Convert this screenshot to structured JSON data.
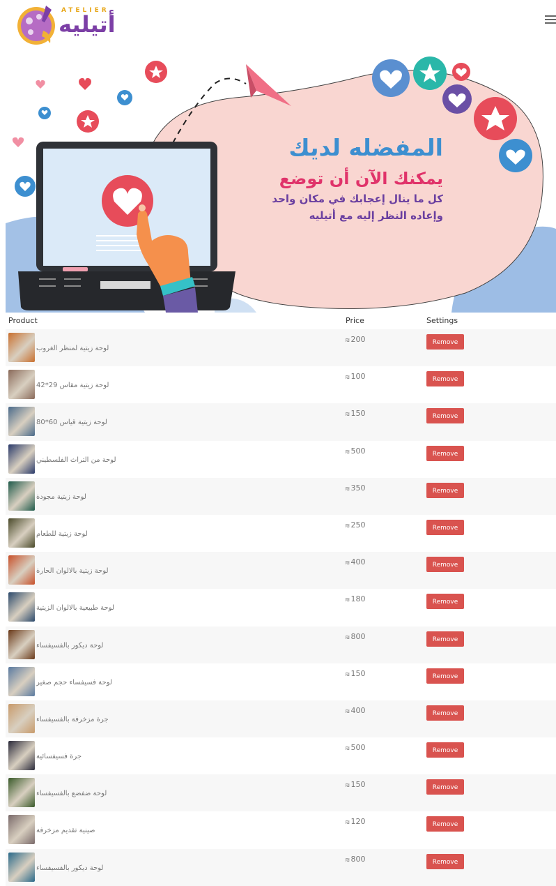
{
  "brand": {
    "latin": "ATELIER",
    "arabic": "أتيليه"
  },
  "banner": {
    "title": "المفضله لديك",
    "subtitle": "يمكنك الآن أن توضع",
    "desc_line1": "كل ما ينال إعجابك في مكان واحد",
    "desc_line2": "وإعاده النظر إليه مع أتيليه"
  },
  "table": {
    "headers": {
      "product": "Product",
      "price": "Price",
      "settings": "Settings"
    },
    "currency_symbol": "₪",
    "remove_label": "Remove",
    "rows": [
      {
        "name": "لوحة زيتية لمنظر الغروب",
        "price": "200",
        "color": "#c9702f"
      },
      {
        "name": "لوحة زيتية مقاس 29*42",
        "price": "100",
        "color": "#8a6a5a"
      },
      {
        "name": "لوحة زيتية قياس 60*80",
        "price": "150",
        "color": "#4a6a8a"
      },
      {
        "name": "لوحة من التراث الفلسطيني",
        "price": "500",
        "color": "#2a3a6a"
      },
      {
        "name": "لوحة زيتية مجودة",
        "price": "350",
        "color": "#1f5a4a"
      },
      {
        "name": "لوحة زيتية للطعام",
        "price": "250",
        "color": "#4a4a2a"
      },
      {
        "name": "لوحة زيتية بالالوان الحارة",
        "price": "400",
        "color": "#c8502a"
      },
      {
        "name": "لوحة طبيعية بالالوان الزيتية",
        "price": "180",
        "color": "#2c4a6c"
      },
      {
        "name": "لوحة ديكور بالفسيفساء",
        "price": "800",
        "color": "#6a3a1a"
      },
      {
        "name": "لوحة فسيفساء حجم صغير",
        "price": "150",
        "color": "#5a7aa0"
      },
      {
        "name": "جرة مزخرفة بالفسيفساء",
        "price": "400",
        "color": "#c89a6a"
      },
      {
        "name": "جرة فسيفسائية",
        "price": "500",
        "color": "#2a2a3a"
      },
      {
        "name": "لوحة ضفضع بالفسيفساء",
        "price": "150",
        "color": "#3a5a2a"
      },
      {
        "name": "صينية تقديم مزخرفة",
        "price": "120",
        "color": "#7a6a6a"
      },
      {
        "name": "لوحة ديكور بالفسيفساء",
        "price": "800",
        "color": "#2a6a8a"
      }
    ]
  }
}
